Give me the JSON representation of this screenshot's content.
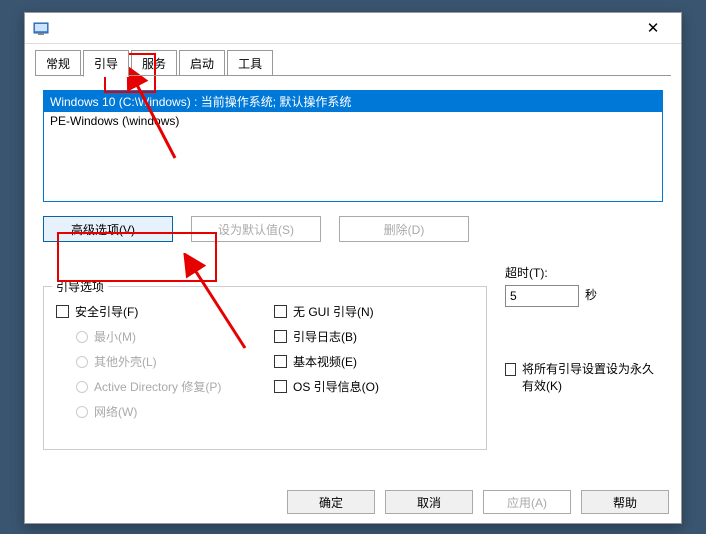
{
  "tabs": {
    "normal": "常规",
    "boot": "引导",
    "services": "服务",
    "startup": "启动",
    "tools": "工具"
  },
  "bootList": {
    "item0": "Windows 10 (C:\\Windows) : 当前操作系统; 默认操作系统",
    "item1": "PE-Windows (\\windows)"
  },
  "buttons": {
    "advanced": "高级选项(V)...",
    "setDefault": "设为默认值(S)",
    "delete": "删除(D)"
  },
  "group": {
    "title": "引导选项",
    "safeBoot": "安全引导(F)",
    "minimal": "最小(M)",
    "altShell": "其他外壳(L)",
    "adRepair": "Active Directory 修复(P)",
    "network": "网络(W)",
    "noGui": "无 GUI 引导(N)",
    "bootLog": "引导日志(B)",
    "baseVideo": "基本视频(E)",
    "osBootInfo": "OS 引导信息(O)"
  },
  "timeout": {
    "label": "超时(T):",
    "value": "5",
    "seconds": "秒"
  },
  "permanent": "将所有引导设置设为永久有效(K)",
  "footer": {
    "ok": "确定",
    "cancel": "取消",
    "apply": "应用(A)",
    "help": "帮助"
  }
}
